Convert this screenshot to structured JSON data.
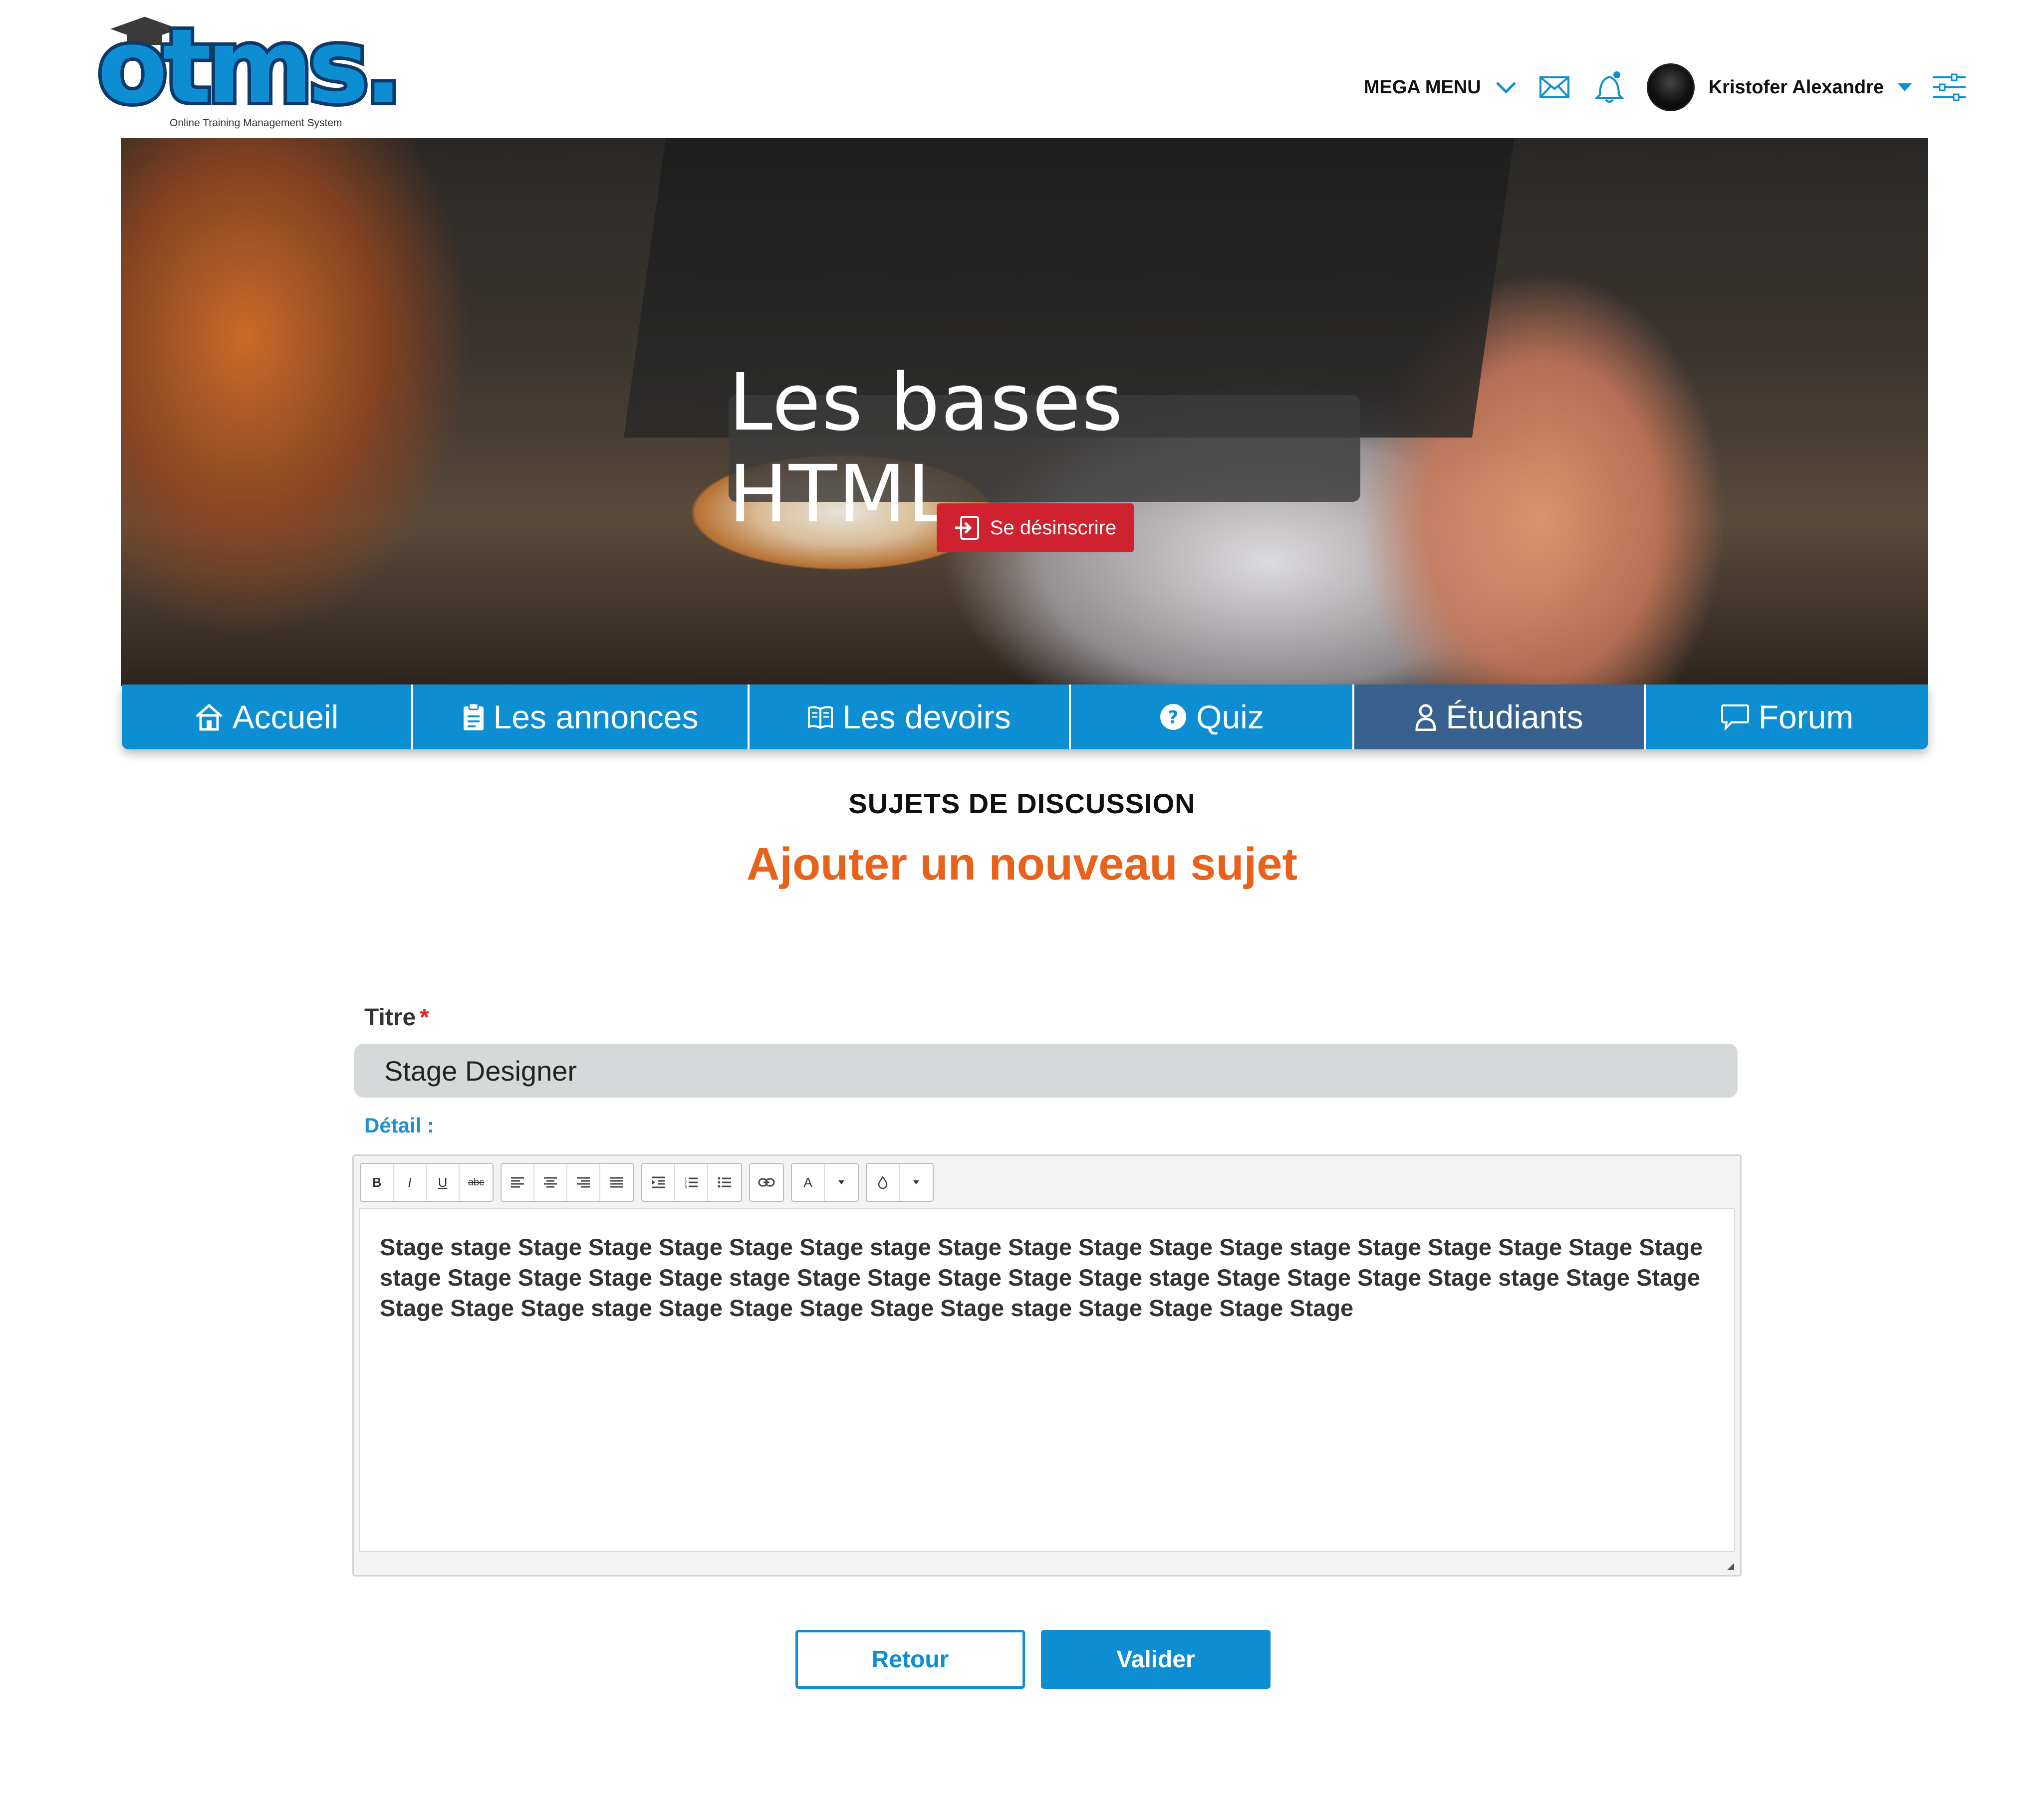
{
  "logo": {
    "text": "otms.",
    "subtitle": "Online Training Management System"
  },
  "topnav": {
    "mega_menu": "MEGA MENU",
    "user_name": "Kristofer Alexandre",
    "accent_color": "#0d8ed3"
  },
  "hero": {
    "course_title": "Les bases HTML",
    "unsubscribe_label": "Se désinscrire"
  },
  "tabs": [
    {
      "label": "Accueil",
      "icon": "home-icon"
    },
    {
      "label": "Les annonces",
      "icon": "clipboard-icon"
    },
    {
      "label": "Les devoirs",
      "icon": "book-icon"
    },
    {
      "label": "Quiz",
      "icon": "question-icon"
    },
    {
      "label": "Étudiants",
      "icon": "user-icon",
      "active": true
    },
    {
      "label": "Forum",
      "icon": "chat-icon"
    }
  ],
  "main": {
    "section_label": "SUJETS DE DISCUSSION",
    "page_title": "Ajouter un nouveau sujet",
    "title_label": "Titre",
    "required_mark": "*",
    "title_value": "Stage Designer",
    "detail_label": "Détail :",
    "detail_text": "Stage stage Stage Stage Stage Stage  Stage stage Stage Stage Stage Stage  Stage stage Stage Stage Stage Stage  Stage stage Stage Stage Stage Stage stage Stage Stage Stage Stage Stage stage Stage Stage Stage Stage stage Stage Stage Stage Stage Stage stage Stage Stage Stage Stage Stage stage Stage Stage Stage Stage",
    "back_label": "Retour",
    "submit_label": "Valider"
  },
  "editor_toolbar": {
    "bold": "B",
    "italic": "I",
    "underline": "U",
    "strike": "abc",
    "font_color": "A"
  }
}
